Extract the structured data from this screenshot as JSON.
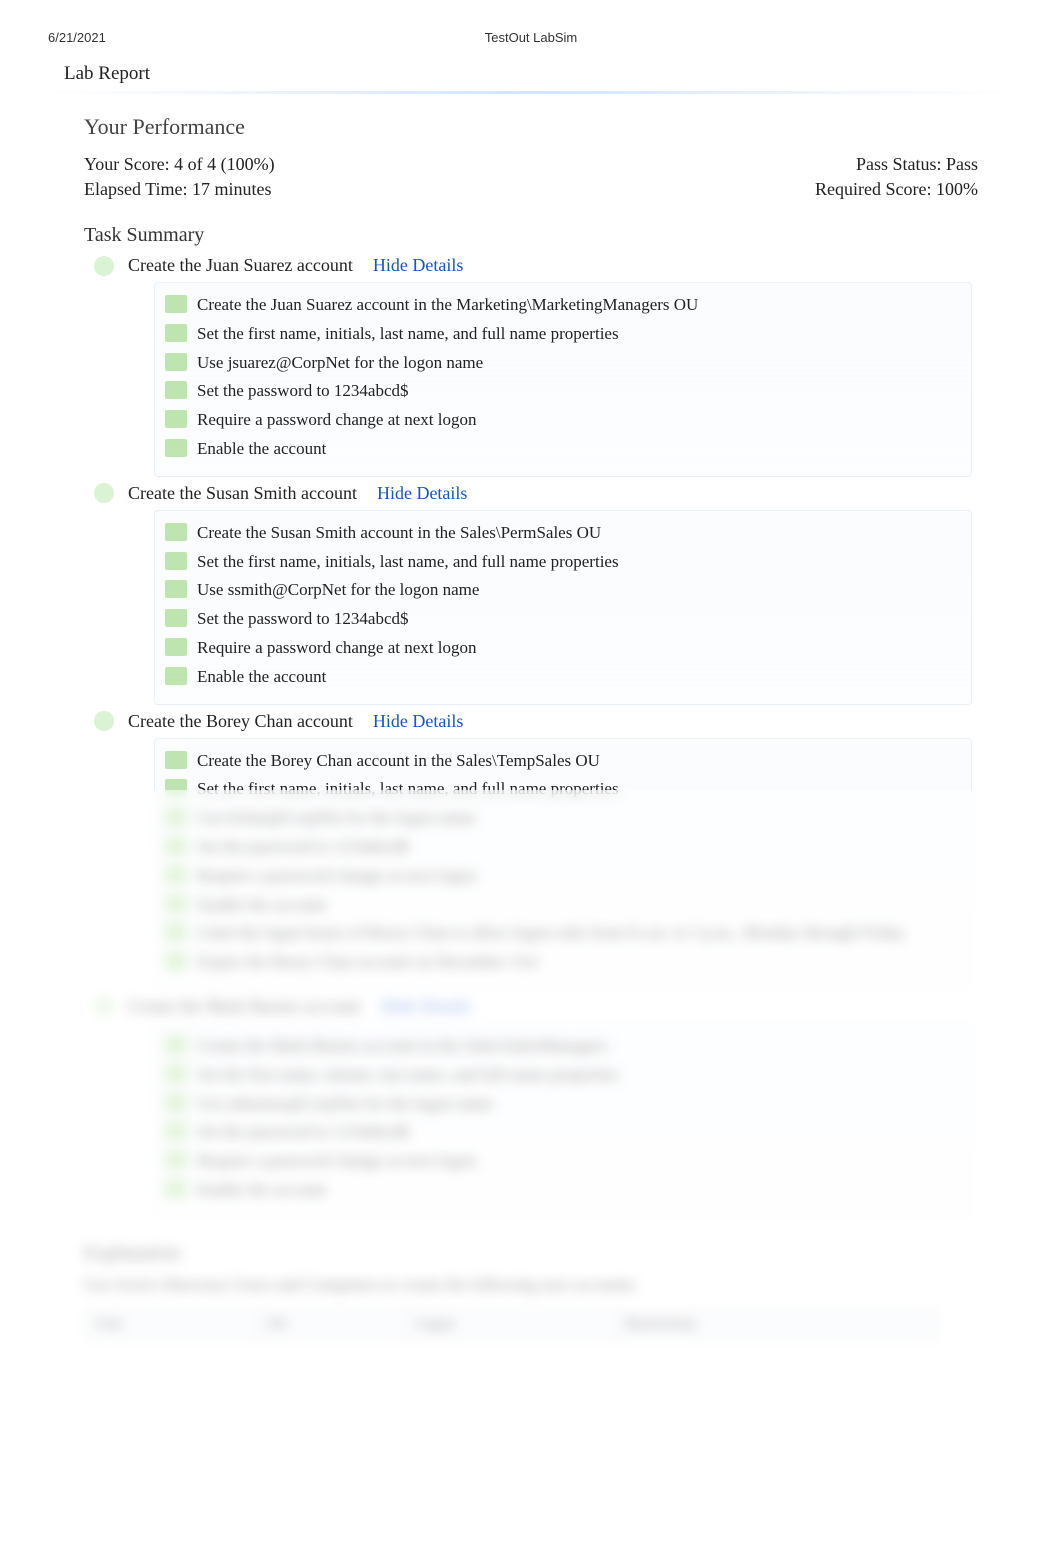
{
  "header": {
    "date": "6/21/2021",
    "title": "TestOut LabSim"
  },
  "report_title": "Lab Report",
  "performance": {
    "title": "Your Performance",
    "score_label": "Your Score: 4 of 4 (100%)",
    "elapsed_label": "Elapsed Time: 17 minutes",
    "pass_label": "Pass Status: Pass",
    "required_label": "Required Score: 100%"
  },
  "task_summary": {
    "title": "Task Summary",
    "hide_details": "Hide Details",
    "tasks": [
      {
        "title": "Create the Juan Suarez account",
        "details": [
          "Create the Juan Suarez account in the Marketing\\MarketingManagers OU",
          "Set the first name, initials, last name, and full name properties",
          "Use jsuarez@CorpNet for the logon name",
          "Set the password to 1234abcd$",
          "Require a password change at next logon",
          "Enable the account"
        ]
      },
      {
        "title": "Create the Susan Smith account",
        "details": [
          "Create the Susan Smith account in the Sales\\PermSales OU",
          "Set the first name, initials, last name, and full name properties",
          "Use ssmith@CorpNet for the logon name",
          "Set the password to 1234abcd$",
          "Require a password change at next logon",
          "Enable the account"
        ]
      },
      {
        "title": "Create the Borey Chan account",
        "details": [
          "Create the Borey Chan account in the Sales\\TempSales OU",
          "Set the first name, initials, last name, and full name properties",
          "Use bchan@CorpNet for the logon name",
          "Set the password to 1234abcd$",
          "Require a password change at next logon",
          "Enable the account",
          "Limit the logon hours of Borey Chan to allow logon only from 8 a.m. to 5 p.m., Monday through Friday",
          "Expire the Borey Chan account on December 31st"
        ]
      },
      {
        "title": "Create the Mark Burnes account",
        "details": [
          "Create the Mark Burnes account in the Sales\\SalesManagers",
          "Set the first name, initials, last name, and full name properties",
          "Use mburnes@CorpNet for the logon name",
          "Set the password to 1234abcd$",
          "Require a password change at next logon",
          "Enable the account"
        ]
      }
    ]
  },
  "explanation": {
    "title": "Explanation",
    "intro": "Use Active Directory Users and Computers to create the following user accounts:",
    "table": {
      "headers": [
        "User",
        "OU",
        "Logon",
        "Restrictions"
      ],
      "rows": []
    }
  }
}
